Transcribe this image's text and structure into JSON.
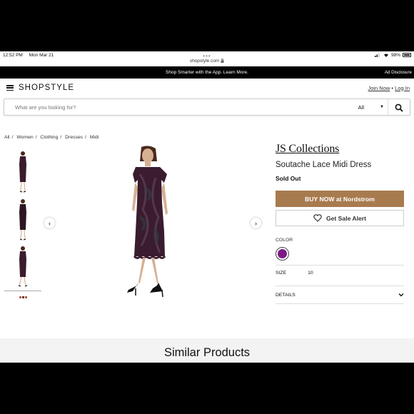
{
  "status_bar": {
    "time": "12:52 PM",
    "date": "Mon Mar 21",
    "battery": "98%"
  },
  "browser": {
    "url": "shopstyle.com",
    "dots": "•••"
  },
  "promo": {
    "text": "Shop Smarter with the App. Learn More.",
    "ad_disclosure": "Ad Disclosure"
  },
  "header": {
    "logo": "SHOPSTYLE",
    "join": "Join Now",
    "separator": "•",
    "login": "Log In"
  },
  "search": {
    "placeholder": "What are you looking for?",
    "category": "All"
  },
  "breadcrumb": [
    "All",
    "Women",
    "Clothing",
    "Dresses",
    "Midi"
  ],
  "product": {
    "brand": "JS Collections",
    "name": "Soutache Lace Midi Dress",
    "status": "Sold Out",
    "buy_button": "BUY NOW at Nordstrom",
    "alert_button": "Get Sale Alert",
    "color_label": "COLOR",
    "color_value": "#7d1a86",
    "size_label": "SIZE",
    "size_value": "10",
    "details_label": "DETAILS"
  },
  "colors": {
    "accent": "#a87b4f",
    "dress": "#3a1c2e",
    "black": "#000000"
  },
  "icons": {
    "menu": "hamburger-icon",
    "search": "search-icon",
    "heart": "heart-icon",
    "prev": "chevron-left-icon",
    "next": "chevron-right-icon",
    "details": "chevron-down-icon"
  },
  "similar": {
    "title": "Similar Products"
  }
}
